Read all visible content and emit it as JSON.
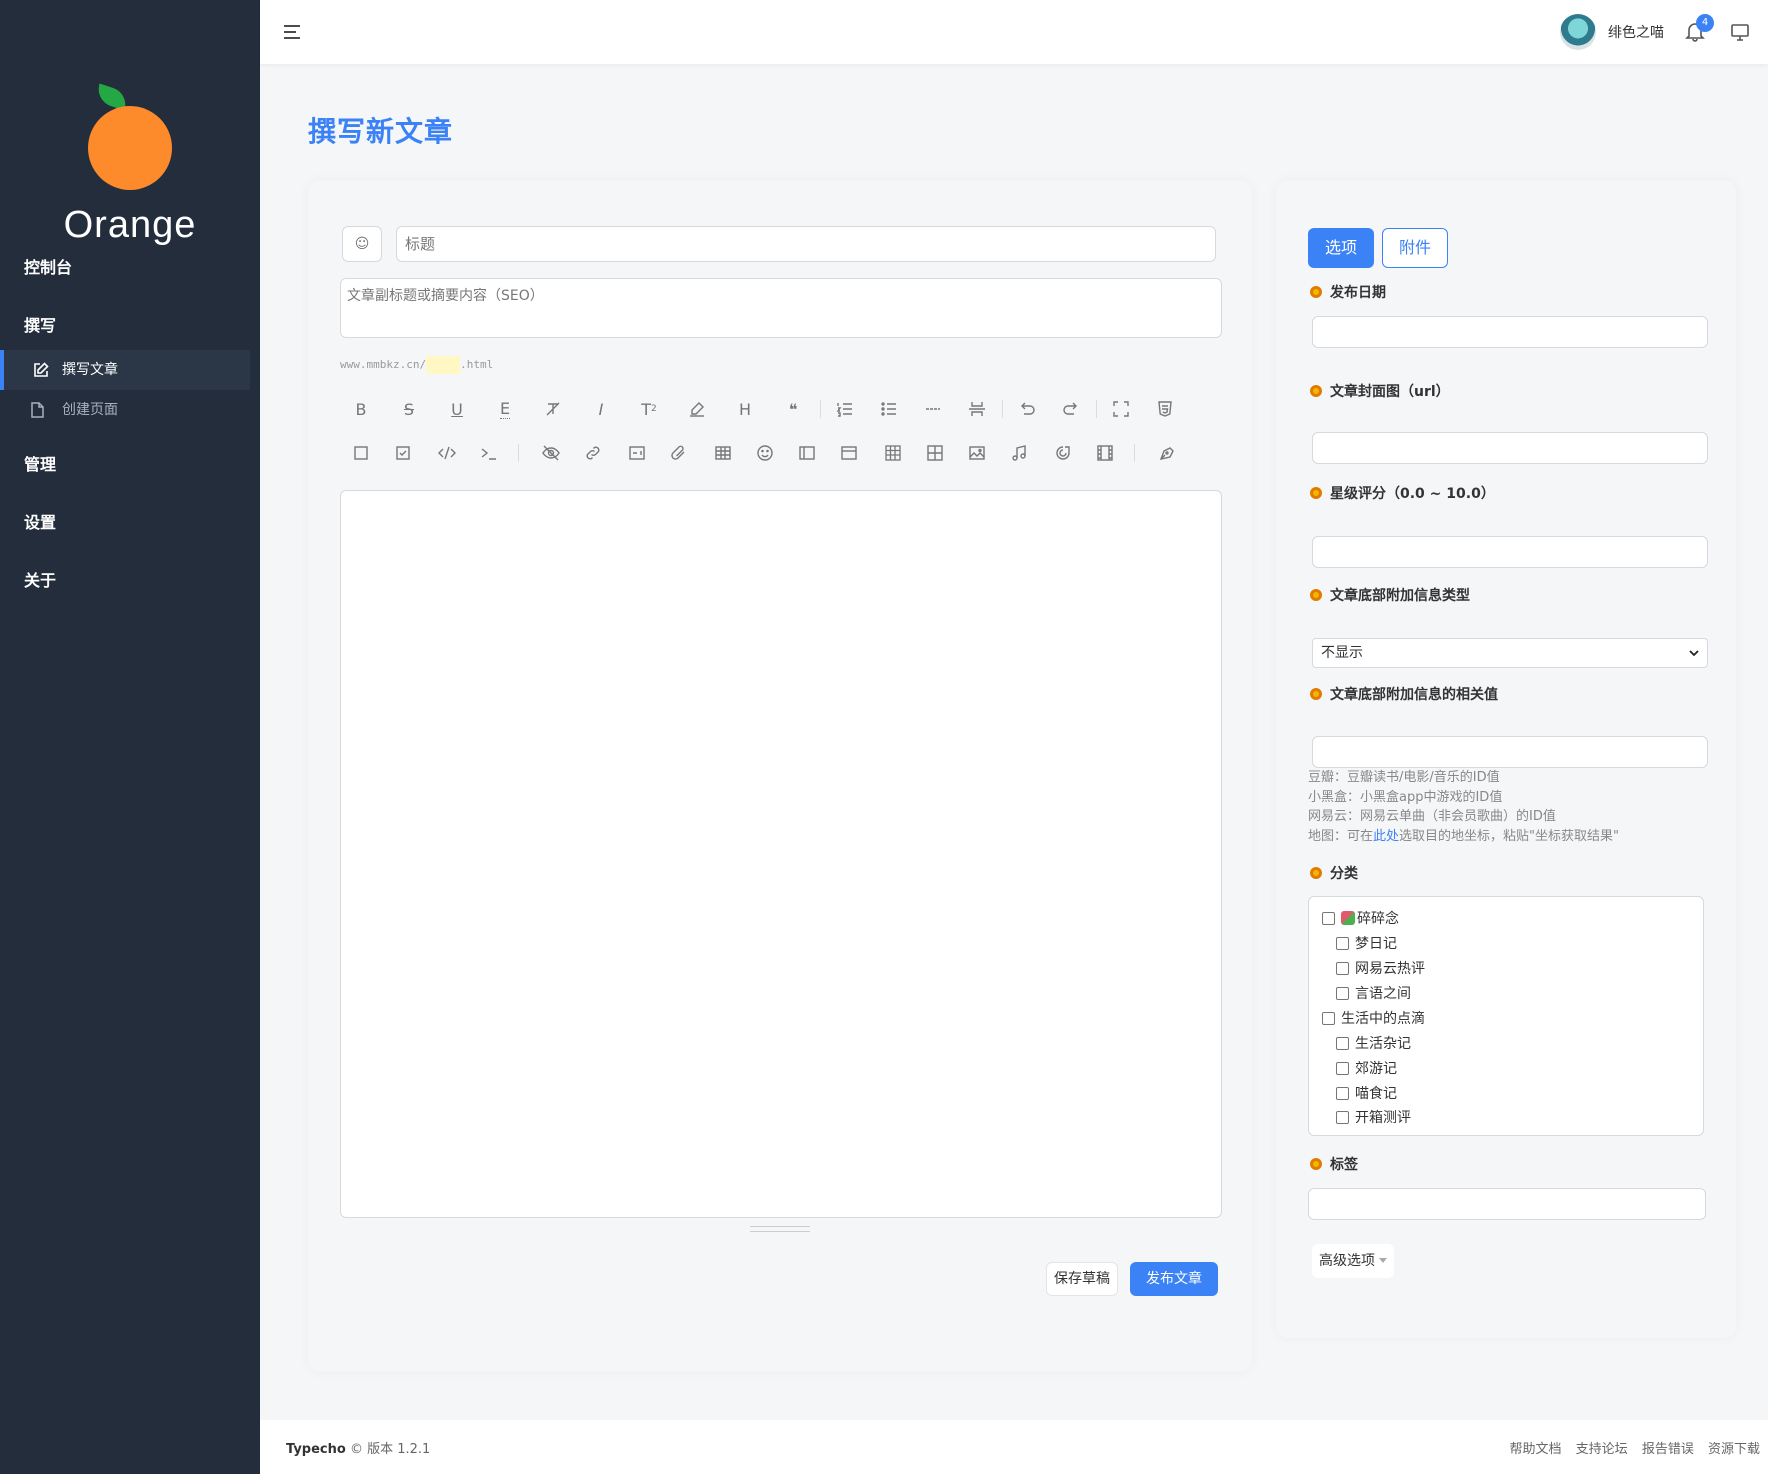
{
  "brand": {
    "name": "Orange",
    "colors": {
      "accent": "#3b82f6",
      "sidebar": "#232d3b",
      "orange": "#fd8a2b",
      "leaf": "#24a845"
    }
  },
  "sidebar": {
    "groups": [
      {
        "label": "控制台"
      },
      {
        "label": "撰写"
      },
      {
        "label": "管理"
      },
      {
        "label": "设置"
      },
      {
        "label": "关于"
      }
    ],
    "items": [
      {
        "label": "撰写文章",
        "icon": "edit-icon",
        "active": true
      },
      {
        "label": "创建页面",
        "icon": "file-icon",
        "active": false
      }
    ]
  },
  "topbar": {
    "username": "绯色之喵",
    "notification_count": "4"
  },
  "page": {
    "title": "撰写新文章"
  },
  "editor": {
    "emoji_button": "☺",
    "title_placeholder": "标题",
    "subtitle_placeholder": "文章副标题或摘要内容（SEO）",
    "url_prefix": "www.mmbkz.cn/",
    "url_suffix": ".html",
    "toolbar_row1": [
      "bold-icon",
      "strikethrough-icon",
      "underline-icon",
      "text-dotted-icon",
      "clear-format-icon",
      "italic-icon",
      "superscript-icon",
      "highlight-icon",
      "heading-icon",
      "quote-icon",
      "ordered-list-icon",
      "unordered-list-icon",
      "horizontal-rule-icon",
      "page-break-icon",
      "undo-icon",
      "redo-icon",
      "fullscreen-icon",
      "html5-icon"
    ],
    "toolbar_row2": [
      "checkbox-empty-icon",
      "checkbox-checked-icon",
      "code-icon",
      "terminal-icon",
      "hide-content-icon",
      "link-icon",
      "embed-icon",
      "attachment-icon",
      "table-icon",
      "emoji-icon",
      "sidebar-layout-icon",
      "card-layout-icon",
      "grid-icon",
      "gallery-icon",
      "photo-icon",
      "music-icon",
      "refresh-spiral-icon",
      "film-icon",
      "pen-icon"
    ],
    "save_draft_label": "保存草稿",
    "publish_label": "发布文章"
  },
  "options": {
    "tab_options": "选项",
    "tab_attachments": "附件",
    "publish_date_label": "发布日期",
    "cover_label": "文章封面图（url）",
    "rating_label": "星级评分（0.0 ~ 10.0）",
    "footer_type_label": "文章底部附加信息类型",
    "footer_type_value": "不显示",
    "footer_value_label": "文章底部附加信息的相关值",
    "help": {
      "douban": "豆瓣：豆瓣读书/电影/音乐的ID值",
      "xiaoheihe": "小黑盒：小黑盒app中游戏的ID值",
      "netease": "网易云：网易云单曲（非会员歌曲）的ID值",
      "map_prefix": "地图：可在",
      "map_link": "此处",
      "map_suffix": "选取目的地坐标，粘贴\"坐标获取结果\""
    },
    "category_label": "分类",
    "categories": [
      {
        "label": "碎碎念",
        "level": 0
      },
      {
        "label": "梦日记",
        "level": 1
      },
      {
        "label": "网易云热评",
        "level": 1
      },
      {
        "label": "言语之间",
        "level": 1
      },
      {
        "label": "生活中的点滴",
        "level": 0
      },
      {
        "label": "生活杂记",
        "level": 1
      },
      {
        "label": "郊游记",
        "level": 1
      },
      {
        "label": "喵食记",
        "level": 1
      },
      {
        "label": "开箱测评",
        "level": 1
      }
    ],
    "tags_label": "标签",
    "advanced_label": "高级选项"
  },
  "footer": {
    "product": "Typecho",
    "version": "© 版本 1.2.1",
    "links": [
      "帮助文档",
      "支持论坛",
      "报告错误",
      "资源下载"
    ]
  }
}
